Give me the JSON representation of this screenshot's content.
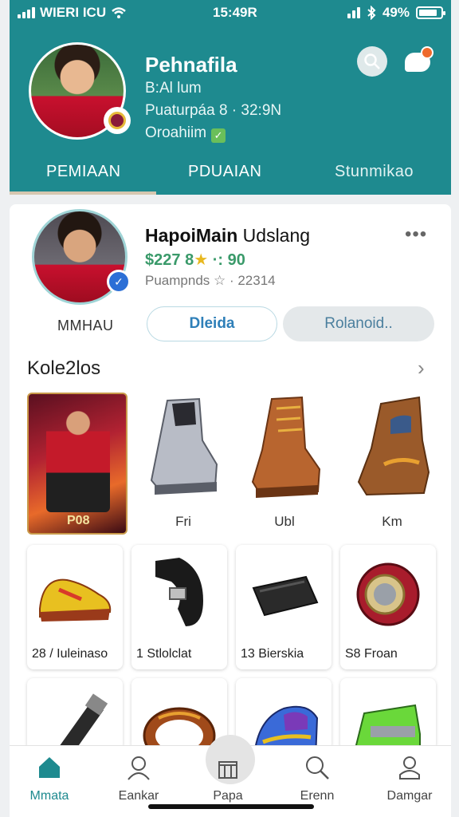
{
  "status_bar": {
    "carrier": "WIERI ICU",
    "time": "15:49R",
    "battery": "49%"
  },
  "profile": {
    "name": "Pehnafila",
    "line1": "B:Al lum",
    "line2": "Puaturpáa 8 · 32:9N",
    "line3": "Oroahiim"
  },
  "tabs": [
    "PEMIAAN",
    "PDUAIAN",
    "Stunmikao"
  ],
  "user": {
    "title_bold": "HapoiMain",
    "title_rest": " Udslang",
    "stats_a": "$227",
    "stats_b": "8",
    "stats_c": "·: 90",
    "sub": "Puampnds ☆ · 22314",
    "handle": "MMHAU",
    "more": "•••"
  },
  "buttons": {
    "primary": "Dleida",
    "secondary": "Rolanoid.."
  },
  "section": {
    "title": "Kole2los"
  },
  "featured": {
    "label": "P08"
  },
  "shoes": [
    {
      "caption": "Fri"
    },
    {
      "caption": "Ubl"
    },
    {
      "caption": "Km"
    }
  ],
  "grid": [
    {
      "caption": "28 / Iuleinaso"
    },
    {
      "caption": "1 Stlolclat"
    },
    {
      "caption": "13 Bierskia"
    },
    {
      "caption": "S8    Froan"
    }
  ],
  "nav": [
    {
      "label": "Mmata"
    },
    {
      "label": "Eankar"
    },
    {
      "label": "Papa"
    },
    {
      "label": "Erenn"
    },
    {
      "label": "Damgar"
    }
  ],
  "colors": {
    "header_teal": "#1e8a8f",
    "accent_blue": "#2e7fb8",
    "stats_green": "#3a9a6a"
  }
}
